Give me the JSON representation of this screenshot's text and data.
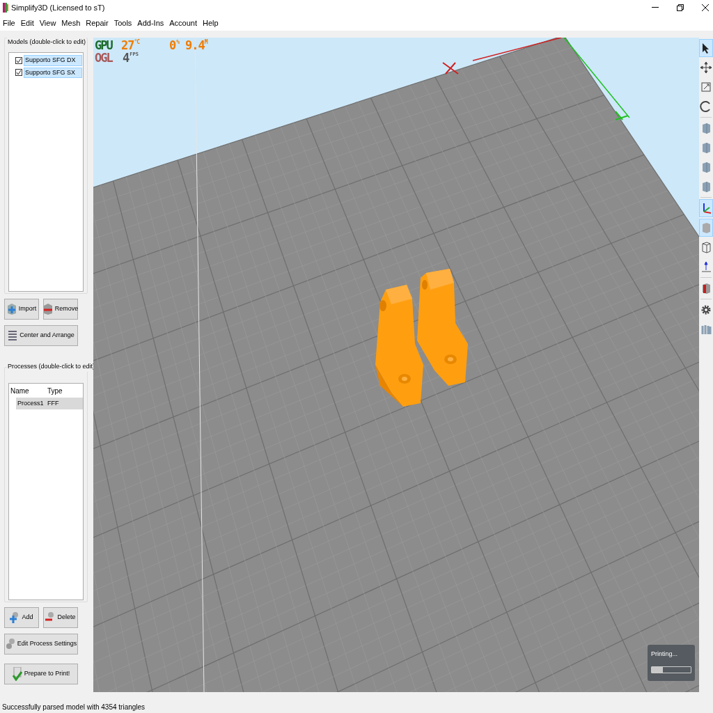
{
  "window": {
    "title": "Simplify3D (Licensed to sT)"
  },
  "menu": [
    "File",
    "Edit",
    "View",
    "Mesh",
    "Repair",
    "Tools",
    "Add-Ins",
    "Account",
    "Help"
  ],
  "models": {
    "title": "Models (double-click to edit)",
    "items": [
      {
        "label": "Supporto SFG DX",
        "checked": true,
        "selected": true
      },
      {
        "label": "Supporto SFG SX",
        "checked": true,
        "selected": true
      }
    ],
    "buttons": [
      {
        "label": "Import",
        "kind": "import"
      },
      {
        "label": "Remove",
        "kind": "remove"
      },
      {
        "label": "Center and Arrange",
        "kind": "arrange"
      }
    ]
  },
  "processes": {
    "title": "Processes (double-click to edit)",
    "columns": [
      "Name",
      "Type"
    ],
    "rows": [
      {
        "cells": [
          "Process1",
          "FFF"
        ],
        "selected": true
      }
    ],
    "buttons": [
      {
        "label": "Add",
        "kind": "add"
      },
      {
        "label": "Delete",
        "kind": "delete"
      },
      {
        "label": "Edit Process Settings",
        "kind": "settings"
      },
      {
        "label": "Prepare to Print!",
        "kind": "prepare"
      }
    ]
  },
  "hud": {
    "gpu_label": "GPU",
    "temp": "27",
    "temp_unit": "°C",
    "usage": "0",
    "usage_unit": "%",
    "memory": "9.4",
    "memory_unit": "M",
    "ogl_label": "OGL",
    "fps": "4",
    "fps_unit": "FPS"
  },
  "print_popup": {
    "text": "Printing...",
    "level": 0.28
  },
  "toolbar": [
    {
      "kind": "pointer",
      "selected": true
    },
    {
      "kind": "move",
      "selected": false
    },
    {
      "kind": "scale",
      "selected": false
    },
    {
      "kind": "rotate",
      "selected": false
    },
    {
      "kind": "view",
      "selected": false
    },
    {
      "kind": "view",
      "selected": false
    },
    {
      "kind": "view",
      "selected": false
    },
    {
      "kind": "view",
      "selected": false
    },
    {
      "kind": "axes",
      "selected": true
    },
    {
      "kind": "solid",
      "selected": true
    },
    {
      "kind": "wireframe",
      "selected": false
    },
    {
      "kind": "normal",
      "selected": false
    },
    {
      "kind": "section",
      "selected": false
    },
    {
      "kind": "gear",
      "selected": false
    },
    {
      "kind": "layers",
      "selected": false
    }
  ],
  "status_bar": "Successfully parsed model with 4354 triangles"
}
